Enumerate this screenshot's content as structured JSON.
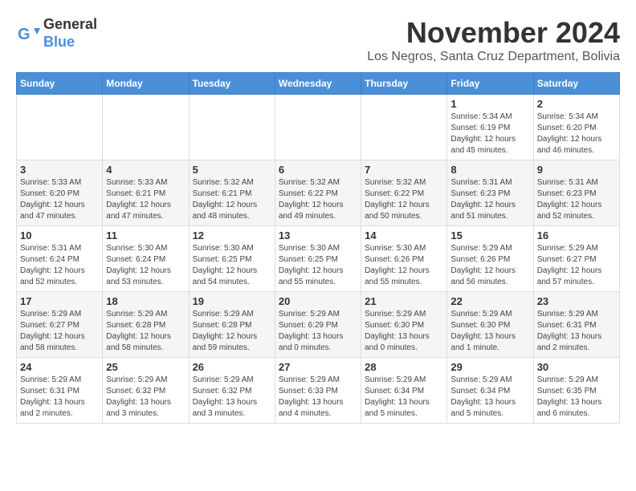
{
  "logo": {
    "line1": "General",
    "line2": "Blue"
  },
  "title": "November 2024",
  "location": "Los Negros, Santa Cruz Department, Bolivia",
  "weekdays": [
    "Sunday",
    "Monday",
    "Tuesday",
    "Wednesday",
    "Thursday",
    "Friday",
    "Saturday"
  ],
  "weeks": [
    [
      {
        "day": "",
        "info": ""
      },
      {
        "day": "",
        "info": ""
      },
      {
        "day": "",
        "info": ""
      },
      {
        "day": "",
        "info": ""
      },
      {
        "day": "",
        "info": ""
      },
      {
        "day": "1",
        "info": "Sunrise: 5:34 AM\nSunset: 6:19 PM\nDaylight: 12 hours\nand 45 minutes."
      },
      {
        "day": "2",
        "info": "Sunrise: 5:34 AM\nSunset: 6:20 PM\nDaylight: 12 hours\nand 46 minutes."
      }
    ],
    [
      {
        "day": "3",
        "info": "Sunrise: 5:33 AM\nSunset: 6:20 PM\nDaylight: 12 hours\nand 47 minutes."
      },
      {
        "day": "4",
        "info": "Sunrise: 5:33 AM\nSunset: 6:21 PM\nDaylight: 12 hours\nand 47 minutes."
      },
      {
        "day": "5",
        "info": "Sunrise: 5:32 AM\nSunset: 6:21 PM\nDaylight: 12 hours\nand 48 minutes."
      },
      {
        "day": "6",
        "info": "Sunrise: 5:32 AM\nSunset: 6:22 PM\nDaylight: 12 hours\nand 49 minutes."
      },
      {
        "day": "7",
        "info": "Sunrise: 5:32 AM\nSunset: 6:22 PM\nDaylight: 12 hours\nand 50 minutes."
      },
      {
        "day": "8",
        "info": "Sunrise: 5:31 AM\nSunset: 6:23 PM\nDaylight: 12 hours\nand 51 minutes."
      },
      {
        "day": "9",
        "info": "Sunrise: 5:31 AM\nSunset: 6:23 PM\nDaylight: 12 hours\nand 52 minutes."
      }
    ],
    [
      {
        "day": "10",
        "info": "Sunrise: 5:31 AM\nSunset: 6:24 PM\nDaylight: 12 hours\nand 52 minutes."
      },
      {
        "day": "11",
        "info": "Sunrise: 5:30 AM\nSunset: 6:24 PM\nDaylight: 12 hours\nand 53 minutes."
      },
      {
        "day": "12",
        "info": "Sunrise: 5:30 AM\nSunset: 6:25 PM\nDaylight: 12 hours\nand 54 minutes."
      },
      {
        "day": "13",
        "info": "Sunrise: 5:30 AM\nSunset: 6:25 PM\nDaylight: 12 hours\nand 55 minutes."
      },
      {
        "day": "14",
        "info": "Sunrise: 5:30 AM\nSunset: 6:26 PM\nDaylight: 12 hours\nand 55 minutes."
      },
      {
        "day": "15",
        "info": "Sunrise: 5:29 AM\nSunset: 6:26 PM\nDaylight: 12 hours\nand 56 minutes."
      },
      {
        "day": "16",
        "info": "Sunrise: 5:29 AM\nSunset: 6:27 PM\nDaylight: 12 hours\nand 57 minutes."
      }
    ],
    [
      {
        "day": "17",
        "info": "Sunrise: 5:29 AM\nSunset: 6:27 PM\nDaylight: 12 hours\nand 58 minutes."
      },
      {
        "day": "18",
        "info": "Sunrise: 5:29 AM\nSunset: 6:28 PM\nDaylight: 12 hours\nand 58 minutes."
      },
      {
        "day": "19",
        "info": "Sunrise: 5:29 AM\nSunset: 6:28 PM\nDaylight: 12 hours\nand 59 minutes."
      },
      {
        "day": "20",
        "info": "Sunrise: 5:29 AM\nSunset: 6:29 PM\nDaylight: 13 hours\nand 0 minutes."
      },
      {
        "day": "21",
        "info": "Sunrise: 5:29 AM\nSunset: 6:30 PM\nDaylight: 13 hours\nand 0 minutes."
      },
      {
        "day": "22",
        "info": "Sunrise: 5:29 AM\nSunset: 6:30 PM\nDaylight: 13 hours\nand 1 minute."
      },
      {
        "day": "23",
        "info": "Sunrise: 5:29 AM\nSunset: 6:31 PM\nDaylight: 13 hours\nand 2 minutes."
      }
    ],
    [
      {
        "day": "24",
        "info": "Sunrise: 5:29 AM\nSunset: 6:31 PM\nDaylight: 13 hours\nand 2 minutes."
      },
      {
        "day": "25",
        "info": "Sunrise: 5:29 AM\nSunset: 6:32 PM\nDaylight: 13 hours\nand 3 minutes."
      },
      {
        "day": "26",
        "info": "Sunrise: 5:29 AM\nSunset: 6:32 PM\nDaylight: 13 hours\nand 3 minutes."
      },
      {
        "day": "27",
        "info": "Sunrise: 5:29 AM\nSunset: 6:33 PM\nDaylight: 13 hours\nand 4 minutes."
      },
      {
        "day": "28",
        "info": "Sunrise: 5:29 AM\nSunset: 6:34 PM\nDaylight: 13 hours\nand 5 minutes."
      },
      {
        "day": "29",
        "info": "Sunrise: 5:29 AM\nSunset: 6:34 PM\nDaylight: 13 hours\nand 5 minutes."
      },
      {
        "day": "30",
        "info": "Sunrise: 5:29 AM\nSunset: 6:35 PM\nDaylight: 13 hours\nand 6 minutes."
      }
    ]
  ]
}
